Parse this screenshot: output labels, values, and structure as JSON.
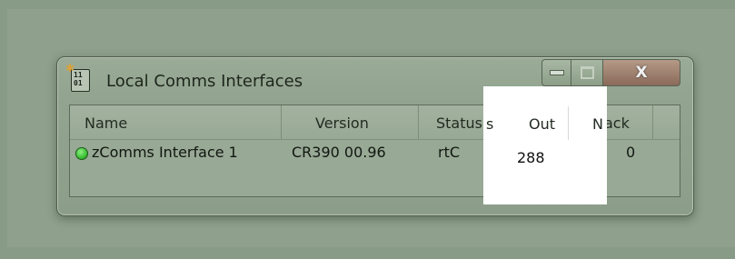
{
  "window": {
    "title": "Local Comms Interfaces",
    "icon_text": "11\n01",
    "buttons": {
      "close_glyph": "X"
    }
  },
  "table": {
    "columns": [
      "Name",
      "Version",
      "Status",
      "Out",
      "Nack"
    ],
    "rows": [
      {
        "status_color": "#2fb72a",
        "name": "zComms Interface 1",
        "version": "CR390 00.96",
        "status": "rtC",
        "out": "288",
        "nack": "0"
      }
    ]
  }
}
